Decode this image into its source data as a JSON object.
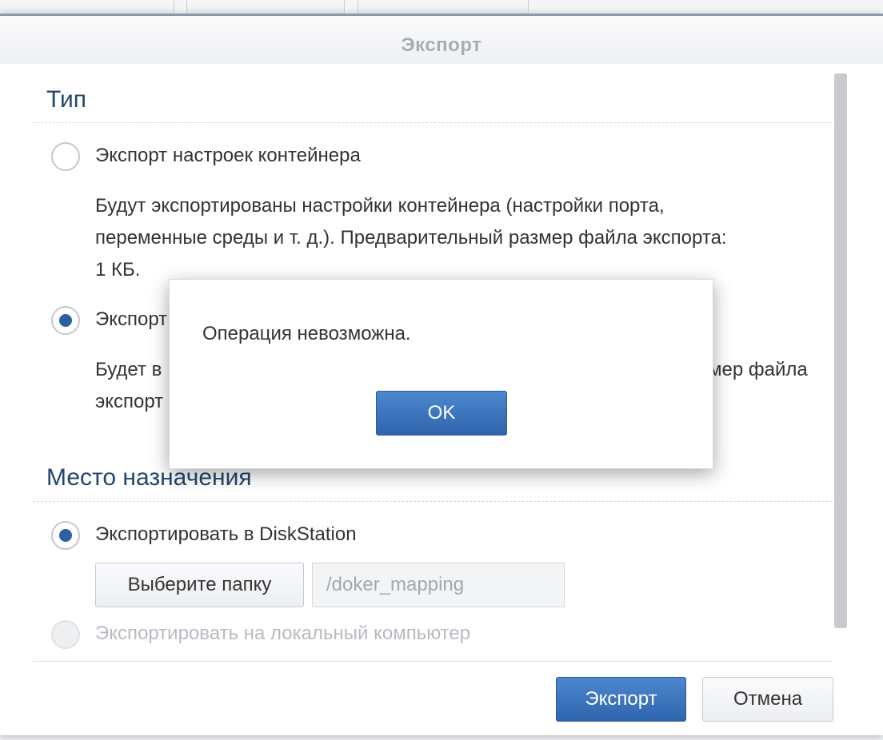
{
  "window": {
    "title": "Экспорт"
  },
  "type_section": {
    "title": "Тип",
    "option_settings": {
      "label": "Экспорт настроек контейнера",
      "checked": false,
      "description_lines": [
        "Будут экспортированы настройки контейнера (настройки порта,",
        "переменные среды и т. д.). Предварительный размер файла экспорта:",
        "1 КБ."
      ]
    },
    "option_container": {
      "label": "Экспорт",
      "checked": true,
      "description_lines": [
        "Будет в",
        "экспорт"
      ],
      "description_right_fragment": "мер файла"
    }
  },
  "destination_section": {
    "title": "Место назначения",
    "option_diskstation": {
      "label": "Экспортировать в DiskStation",
      "checked": true
    },
    "choose_folder_label": "Выберите папку",
    "folder_path_placeholder": "/doker_mapping",
    "option_local": {
      "label": "Экспортировать на локальный компьютер",
      "disabled": true
    }
  },
  "footer": {
    "export_label": "Экспорт",
    "cancel_label": "Отмена"
  },
  "alert": {
    "message": "Операция невозможна.",
    "ok_label": "OK"
  },
  "colors": {
    "accent": "#2f64ad",
    "section_title": "#23466e",
    "radio_checked": "#2d5fa3"
  }
}
